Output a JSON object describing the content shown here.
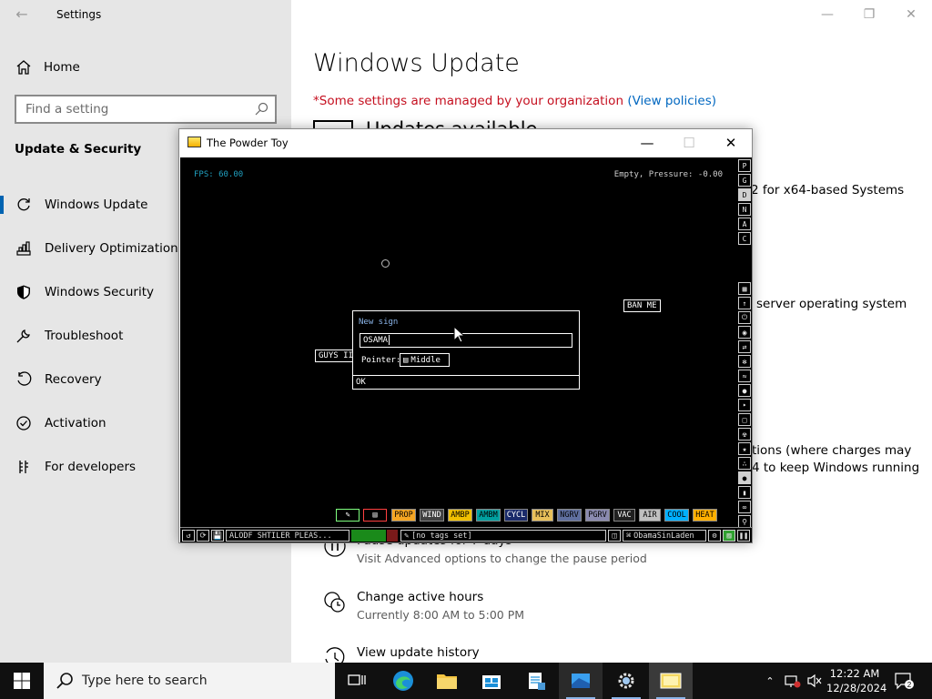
{
  "settings": {
    "app_title": "Settings",
    "home": "Home",
    "search_placeholder": "Find a setting",
    "section": "Update & Security",
    "nav": [
      {
        "label": "Windows Update",
        "icon": "refresh-icon"
      },
      {
        "label": "Delivery Optimization",
        "icon": "delivery-icon"
      },
      {
        "label": "Windows Security",
        "icon": "shield-icon"
      },
      {
        "label": "Troubleshoot",
        "icon": "wrench-icon"
      },
      {
        "label": "Recovery",
        "icon": "recovery-icon"
      },
      {
        "label": "Activation",
        "icon": "check-circle-icon"
      },
      {
        "label": "For developers",
        "icon": "developer-icon"
      }
    ],
    "page_title": "Windows Update",
    "managed_text": "*Some settings are managed by your organization",
    "managed_link": "(View policies)",
    "partial_heading": "Updates available",
    "update_line_1": "2 for x64-based Systems",
    "update_line_2": "server operating system",
    "update_line_3": "tions (where charges may",
    "update_line_4": "4 to keep Windows running",
    "options": [
      {
        "title": "Pause updates for 7 days",
        "sub": "Visit Advanced options to change the pause period",
        "icon": "pause-icon"
      },
      {
        "title": "Change active hours",
        "sub": "Currently 8:00 AM to 5:00 PM",
        "icon": "clock-icon"
      },
      {
        "title": "View update history",
        "sub": "",
        "icon": "history-icon"
      }
    ]
  },
  "tpt": {
    "window_title": "The Powder Toy",
    "fps": "FPS: 60.00",
    "pressure": "Empty, Pressure: -0.00",
    "right_top": [
      "P",
      "G",
      "D",
      "N",
      "A",
      "C"
    ],
    "signs": {
      "ban": "BAN ME",
      "guys": "GUYS II"
    },
    "dialog": {
      "title": "New sign",
      "input_value": "OSAMA",
      "pointer_label": "Pointer:",
      "pointer_value": "Middle",
      "ok": "OK"
    },
    "menu": [
      {
        "label": "PROP",
        "bg": "#f5a623"
      },
      {
        "label": "WIND",
        "bg": "#404040",
        "fg": "#ffffff"
      },
      {
        "label": "AMBP",
        "bg": "#f0c000"
      },
      {
        "label": "AMBM",
        "bg": "#00a0a0"
      },
      {
        "label": "CYCL",
        "bg": "#1a2a6a",
        "fg": "#ffffff"
      },
      {
        "label": "MIX",
        "bg": "#e8c05a"
      },
      {
        "label": "NGRV",
        "bg": "#6070a0"
      },
      {
        "label": "PGRV",
        "bg": "#8a8ab0"
      },
      {
        "label": "VAC",
        "bg": "#202020",
        "fg": "#ffffff"
      },
      {
        "label": "AIR",
        "bg": "#c0c0c0"
      },
      {
        "label": "COOL",
        "bg": "#00b0ff"
      },
      {
        "label": "HEAT",
        "bg": "#ffb000"
      }
    ],
    "save_name": "ALODF SHTILER PLEAS...",
    "tags": "[no tags set]",
    "user": "ObamaSinLaden"
  },
  "taskbar": {
    "search_placeholder": "Type here to search",
    "time": "12:22 AM",
    "date": "12/28/2024",
    "notif_count": "2"
  },
  "colors": {
    "accent": "#0063b1",
    "link": "#0067c0",
    "warning": "#c50f1f"
  }
}
